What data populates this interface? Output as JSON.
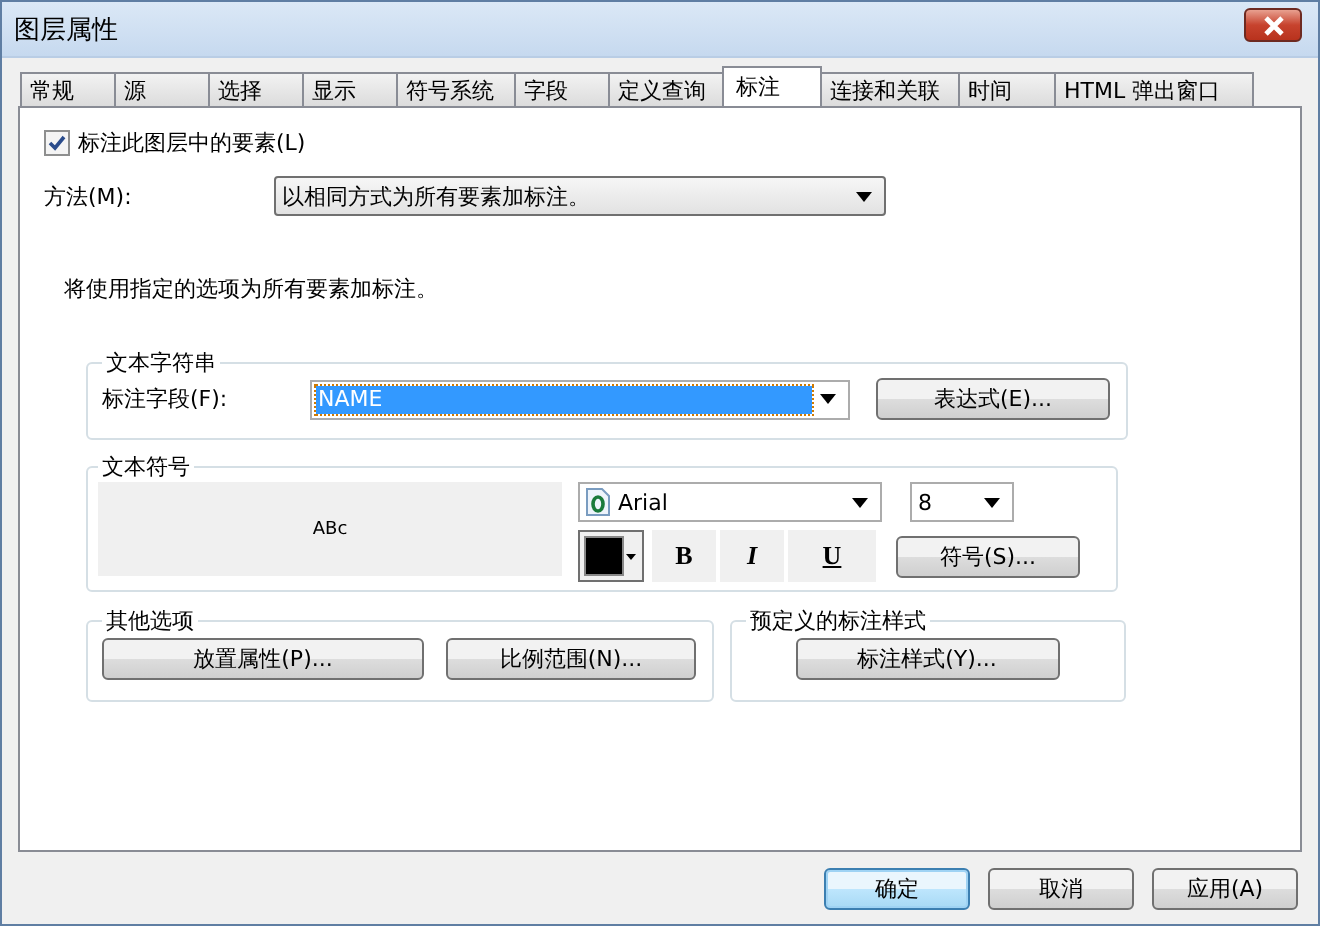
{
  "window": {
    "title": "图层属性"
  },
  "tabs": [
    {
      "label": "常规",
      "selected": false
    },
    {
      "label": "源",
      "selected": false
    },
    {
      "label": "选择",
      "selected": false
    },
    {
      "label": "显示",
      "selected": false
    },
    {
      "label": "符号系统",
      "selected": false
    },
    {
      "label": "字段",
      "selected": false
    },
    {
      "label": "定义查询",
      "selected": false
    },
    {
      "label": "标注",
      "selected": true
    },
    {
      "label": "连接和关联",
      "selected": false
    },
    {
      "label": "时间",
      "selected": false
    },
    {
      "label": "HTML 弹出窗口",
      "selected": false
    }
  ],
  "label_features": {
    "label": "标注此图层中的要素(L)",
    "checked": true
  },
  "method": {
    "label": "方法(M):",
    "value": "以相同方式为所有要素加标注。"
  },
  "description": "将使用指定的选项为所有要素加标注。",
  "text_string": {
    "title": "文本字符串",
    "field_label": "标注字段(F):",
    "field_value": "NAME",
    "expression_button": "表达式(E)..."
  },
  "text_symbol": {
    "title": "文本符号",
    "preview": "ABc",
    "font": "Arial",
    "size": "8",
    "bold": "B",
    "italic": "I",
    "underline": "U",
    "symbol_button": "符号(S)..."
  },
  "other_options": {
    "title": "其他选项",
    "buttons": [
      "放置属性(P)...",
      "比例范围(N)..."
    ]
  },
  "predefined": {
    "title": "预定义的标注样式",
    "button": "标注样式(Y)..."
  },
  "footer": [
    {
      "label": "确定",
      "default": true
    },
    {
      "label": "取消",
      "default": false
    },
    {
      "label": "应用(A)",
      "default": false
    }
  ]
}
